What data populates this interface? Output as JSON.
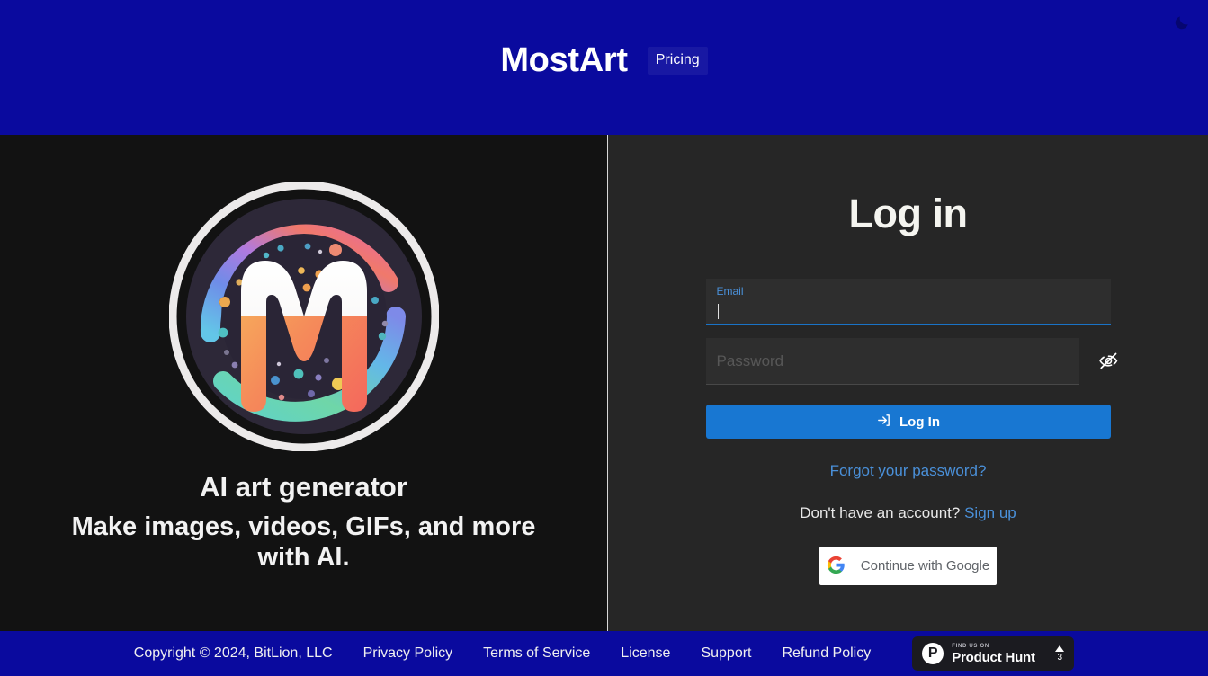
{
  "header": {
    "brand": "MostArt",
    "pricing_label": "Pricing",
    "theme_toggle_icon": "moon-icon",
    "background_color": "#0a0a9e"
  },
  "hero": {
    "logo_icon": "mostart-logo-icon",
    "tagline_main": "AI art generator",
    "tagline_sub": "Make images, videos, GIFs, and more with AI."
  },
  "login": {
    "title": "Log in",
    "email": {
      "label": "Email",
      "value": "",
      "placeholder": "Email",
      "focused": true,
      "accent_color": "#1a73c7"
    },
    "password": {
      "label": "Password",
      "value": "",
      "placeholder": "Password",
      "toggle_icon": "eye-off-icon"
    },
    "submit_label": "Log In",
    "submit_icon": "login-arrow-icon",
    "submit_color": "#1877d2",
    "forgot_label": "Forgot your password?",
    "signup_prompt": "Don't have an account?",
    "signup_label": "Sign up",
    "google_label": "Continue with Google",
    "google_icon": "google-g-icon",
    "link_color": "#4a90d9"
  },
  "footer": {
    "copyright": "Copyright © 2024, BitLion, LLC",
    "links": [
      {
        "label": "Privacy Policy"
      },
      {
        "label": "Terms of Service"
      },
      {
        "label": "License"
      },
      {
        "label": "Support"
      },
      {
        "label": "Refund Policy"
      }
    ],
    "product_hunt": {
      "kicker": "FIND US ON",
      "name": "Product Hunt",
      "votes": "3",
      "logo_icon": "product-hunt-icon",
      "upvote_icon": "triangle-up-icon"
    },
    "background_color": "#0a0a9e"
  }
}
